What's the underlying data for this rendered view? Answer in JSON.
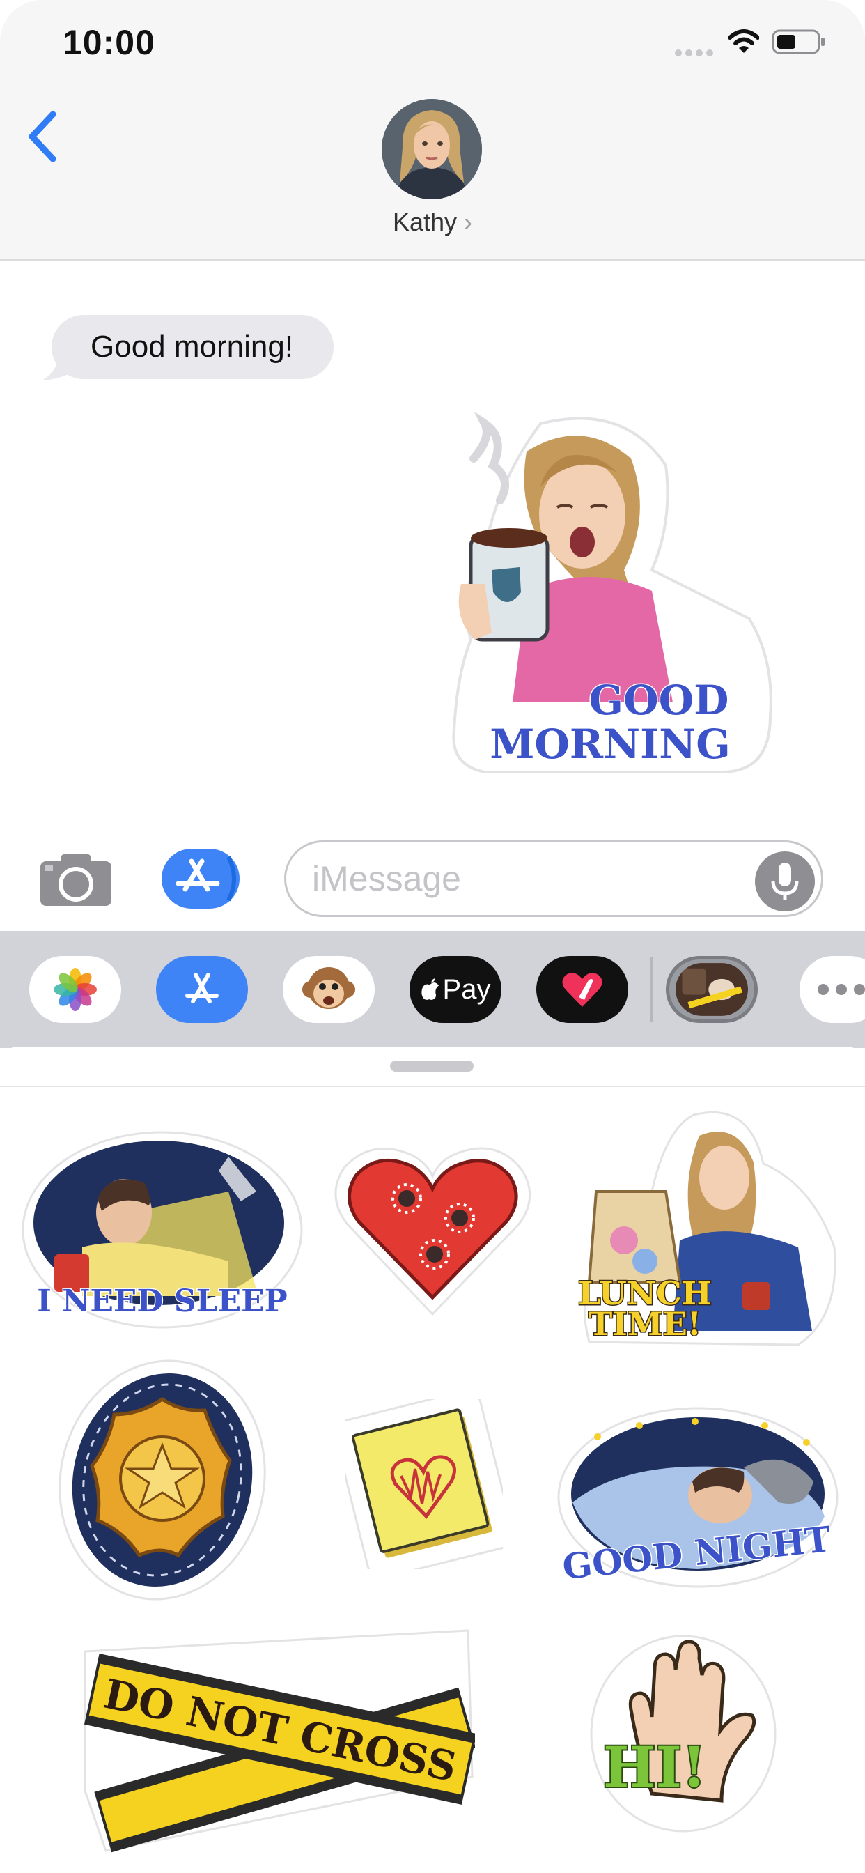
{
  "status_bar": {
    "time": "10:00"
  },
  "header": {
    "contact_name": "Kathy",
    "chevron": "›"
  },
  "conversation": {
    "received_message": "Good morning!",
    "sent_sticker": {
      "icon": "good-morning-sticker",
      "line1": "GOOD",
      "line2": "MORNING"
    }
  },
  "input_bar": {
    "placeholder": "iMessage"
  },
  "app_drawer": {
    "apps": [
      {
        "icon": "photos-icon"
      },
      {
        "icon": "app-store-icon"
      },
      {
        "icon": "animoji-monkey-icon"
      },
      {
        "icon": "apple-pay-icon",
        "label": "Pay"
      },
      {
        "icon": "digital-touch-icon"
      },
      {
        "icon": "police-sticker-app-icon"
      },
      {
        "icon": "more-icon"
      }
    ]
  },
  "stickers": [
    {
      "icon": "i-need-sleep-sticker",
      "label": "I NEED SLEEP"
    },
    {
      "icon": "bullet-heart-sticker"
    },
    {
      "icon": "lunch-time-sticker",
      "label_line1": "LUNCH",
      "label_line2": "TIME!"
    },
    {
      "icon": "police-badge-sticker"
    },
    {
      "icon": "heart-note-sticker"
    },
    {
      "icon": "good-night-sticker",
      "label": "GOOD NIGHT"
    },
    {
      "icon": "do-not-cross-sticker",
      "label": "DO NOT CROSS"
    },
    {
      "icon": "hi-hand-sticker",
      "label": "HI!"
    }
  ],
  "colors": {
    "accent_blue": "#3e84f6",
    "sticker_text_blue": "#3b52c8",
    "sticker_text_yellow": "#f6d12a",
    "tape_yellow": "#f4d21f"
  }
}
